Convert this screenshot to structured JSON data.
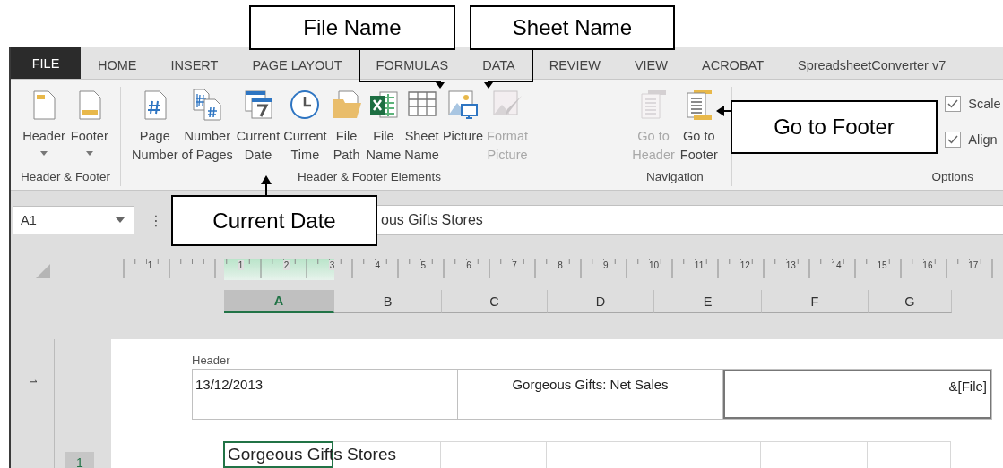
{
  "callouts": [
    {
      "text": "File Name"
    },
    {
      "text": "Sheet Name"
    },
    {
      "text": "Go to Footer"
    },
    {
      "text": "Current Date"
    }
  ],
  "tabs": [
    {
      "label": "FILE",
      "selected": true
    },
    {
      "label": "HOME",
      "selected": false
    },
    {
      "label": "INSERT",
      "selected": false
    },
    {
      "label": "PAGE LAYOUT",
      "selected": false
    },
    {
      "label": "FORMULAS",
      "selected": false
    },
    {
      "label": "DATA",
      "selected": false
    },
    {
      "label": "REVIEW",
      "selected": false
    },
    {
      "label": "VIEW",
      "selected": false
    },
    {
      "label": "ACROBAT",
      "selected": false
    },
    {
      "label": "SpreadsheetConverter v7",
      "selected": false
    }
  ],
  "ribbon": {
    "groups": [
      {
        "kind": "buttons",
        "label": "Header & Footer",
        "buttons": [
          {
            "label": "Header",
            "dropdown": true,
            "disabled": false
          },
          {
            "label": "Footer",
            "dropdown": true,
            "disabled": false
          }
        ]
      },
      {
        "kind": "buttons",
        "label": "Header & Footer Elements",
        "buttons": [
          {
            "label": "Page\nNumber",
            "dropdown": false,
            "disabled": false
          },
          {
            "label": "Number\nof Pages",
            "dropdown": false,
            "disabled": false
          },
          {
            "label": "Current\nDate",
            "dropdown": false,
            "disabled": false
          },
          {
            "label": "Current\nTime",
            "dropdown": false,
            "disabled": false
          },
          {
            "label": "File\nPath",
            "dropdown": false,
            "disabled": false
          },
          {
            "label": "File\nName",
            "dropdown": false,
            "disabled": false
          },
          {
            "label": "Sheet\nName",
            "dropdown": false,
            "disabled": false
          },
          {
            "label": "Picture",
            "dropdown": false,
            "disabled": false
          },
          {
            "label": "Format\nPicture",
            "dropdown": false,
            "disabled": true
          }
        ]
      },
      {
        "kind": "buttons",
        "label": "Navigation",
        "buttons": [
          {
            "label": "Go to\nHeader",
            "dropdown": false,
            "disabled": true
          },
          {
            "label": "Go to\nFooter",
            "dropdown": false,
            "disabled": false
          }
        ]
      },
      {
        "kind": "options",
        "label": "Options",
        "options": [
          {
            "label": "Scale",
            "checked": true
          },
          {
            "label": "Align",
            "checked": true
          }
        ]
      }
    ]
  },
  "formula_bar": {
    "name_box": "A1",
    "dots": "⋮",
    "formula": "ous Gifts Stores"
  },
  "ruler": {
    "labels": [
      "1",
      "1",
      "2",
      "3",
      "4",
      "5",
      "6",
      "7",
      "8",
      "9",
      "10",
      "11",
      "12",
      "13",
      "14",
      "15",
      "16",
      "17"
    ]
  },
  "vertical_ruler": {
    "label": "1"
  },
  "columns": [
    {
      "label": "A",
      "selected": true
    },
    {
      "label": "B",
      "selected": false
    },
    {
      "label": "C",
      "selected": false
    },
    {
      "label": "D",
      "selected": false
    },
    {
      "label": "E",
      "selected": false
    },
    {
      "label": "F",
      "selected": false
    },
    {
      "label": "G",
      "selected": false
    }
  ],
  "header": {
    "label": "Header",
    "sections": [
      {
        "text": "13/12/2013",
        "selected": false
      },
      {
        "text": "Gorgeous Gifts: Net Sales",
        "selected": false
      },
      {
        "text": "&[File]",
        "selected": true
      }
    ]
  },
  "rows": [
    {
      "header": "1",
      "cells": [
        {
          "text": "Gorgeous Gifts Stores",
          "selected": true
        }
      ]
    }
  ]
}
